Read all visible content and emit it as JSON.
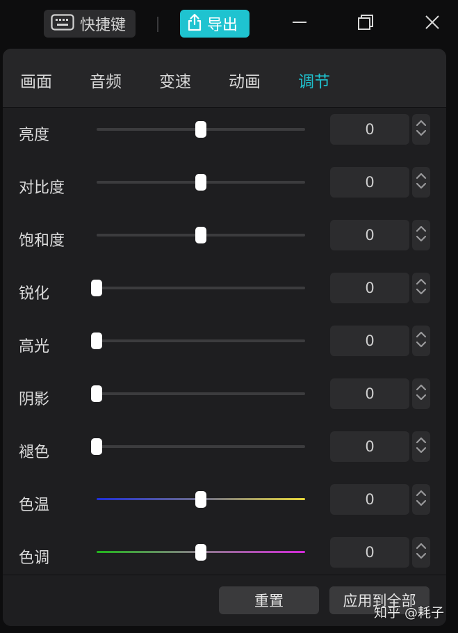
{
  "titlebar": {
    "shortcut_label": "快捷键",
    "export_label": "导出",
    "accent_color": "#1fc3d0"
  },
  "tabs": [
    {
      "label": "画面",
      "active": false
    },
    {
      "label": "音频",
      "active": false
    },
    {
      "label": "变速",
      "active": false
    },
    {
      "label": "动画",
      "active": false
    },
    {
      "label": "调节",
      "active": true
    }
  ],
  "adjustments": [
    {
      "label": "亮度",
      "value": "0",
      "level": 0.5,
      "track": "plain"
    },
    {
      "label": "对比度",
      "value": "0",
      "level": 0.5,
      "track": "plain"
    },
    {
      "label": "饱和度",
      "value": "0",
      "level": 0.5,
      "track": "plain"
    },
    {
      "label": "锐化",
      "value": "0",
      "level": 0.0,
      "track": "plain"
    },
    {
      "label": "高光",
      "value": "0",
      "level": 0.0,
      "track": "plain"
    },
    {
      "label": "阴影",
      "value": "0",
      "level": 0.0,
      "track": "plain"
    },
    {
      "label": "褪色",
      "value": "0",
      "level": 0.0,
      "track": "plain"
    },
    {
      "label": "色温",
      "value": "0",
      "level": 0.5,
      "track": "blue-yellow"
    },
    {
      "label": "色调",
      "value": "0",
      "level": 0.5,
      "track": "green-magenta"
    }
  ],
  "footer": {
    "reset_label": "重置",
    "apply_all_label": "应用到全部"
  },
  "watermark": "知乎 @耗子"
}
